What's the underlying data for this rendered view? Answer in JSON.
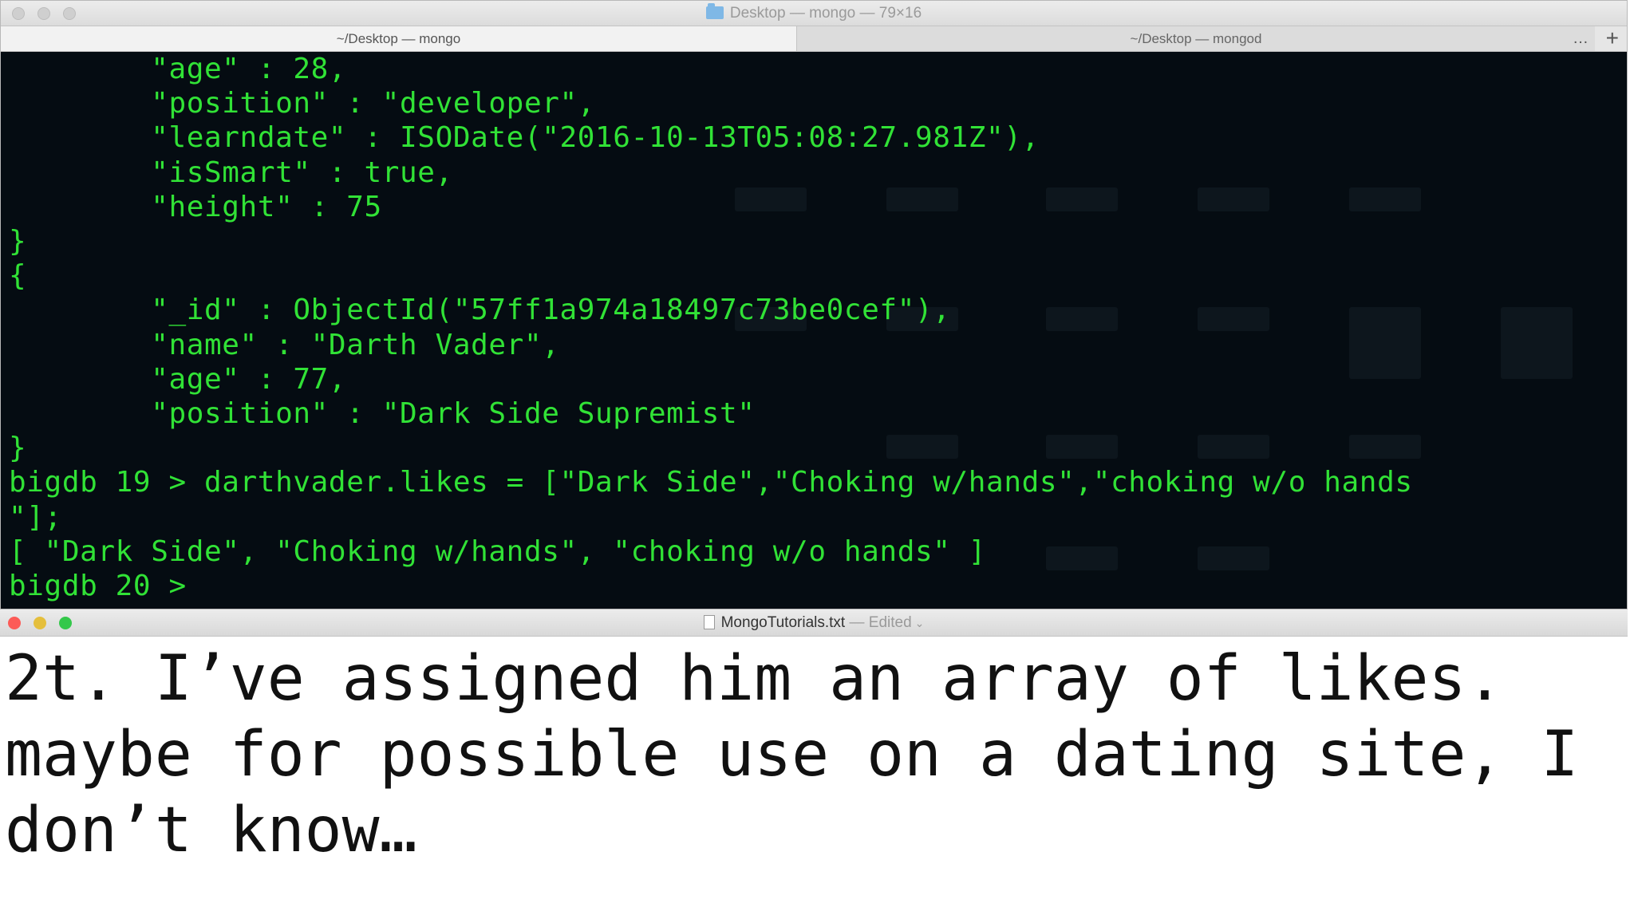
{
  "terminal": {
    "window_title": "Desktop — mongo — 79×16",
    "tabs": [
      {
        "label": "~/Desktop — mongo",
        "active": true
      },
      {
        "label": "~/Desktop — mongod",
        "active": false
      }
    ],
    "more_label": "…",
    "add_label": "+",
    "output_lines": [
      "        \"age\" : 28,",
      "        \"position\" : \"developer\",",
      "        \"learndate\" : ISODate(\"2016-10-13T05:08:27.981Z\"),",
      "        \"isSmart\" : true,",
      "        \"height\" : 75",
      "}",
      "{",
      "        \"_id\" : ObjectId(\"57ff1a974a18497c73be0cef\"),",
      "        \"name\" : \"Darth Vader\",",
      "        \"age\" : 77,",
      "        \"position\" : \"Dark Side Supremist\"",
      "}",
      "bigdb 19 > darthvader.likes = [\"Dark Side\",\"Choking w/hands\",\"choking w/o hands",
      "\"];",
      "[ \"Dark Side\", \"Choking w/hands\", \"choking w/o hands\" ]",
      "bigdb 20 > "
    ],
    "colors": {
      "background": "#050c12",
      "text": "#31e236"
    }
  },
  "editor": {
    "filename": "MongoTutorials.txt",
    "separator": " — ",
    "status": "Edited",
    "text": "2t. I’ve assigned him an array of likes. maybe for possible use on a dating site, I don’t know…"
  }
}
